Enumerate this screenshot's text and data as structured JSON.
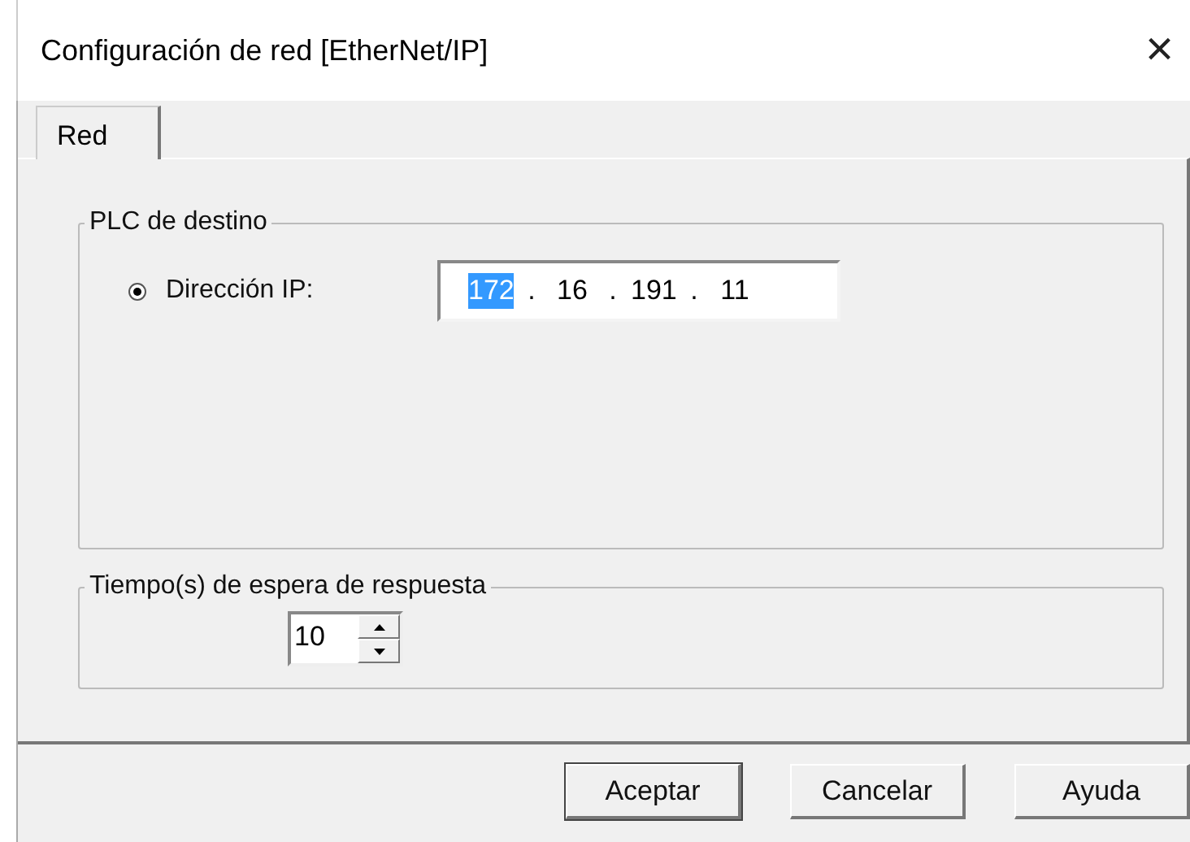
{
  "window": {
    "title": "Configuración de red [EtherNet/IP]",
    "close": "×"
  },
  "tabs": [
    {
      "label": "Red",
      "selected": true
    }
  ],
  "target_group": {
    "title": "PLC de destino",
    "radio": {
      "label": "Dirección IP:",
      "checked": true
    },
    "ip_octets": [
      {
        "text": "172",
        "selected": true
      },
      {
        "text": "16",
        "selected": false
      },
      {
        "text": "191",
        "selected": false
      },
      {
        "text": "11",
        "selected": false
      }
    ],
    "separator": "."
  },
  "timeout_group": {
    "title": "Tiempo(s) de espera de respuesta",
    "value": "10"
  },
  "buttons": [
    {
      "label": "Aceptar",
      "default": true
    },
    {
      "label": "Cancelar",
      "default": false
    },
    {
      "label": "Ayuda",
      "default": false
    }
  ]
}
